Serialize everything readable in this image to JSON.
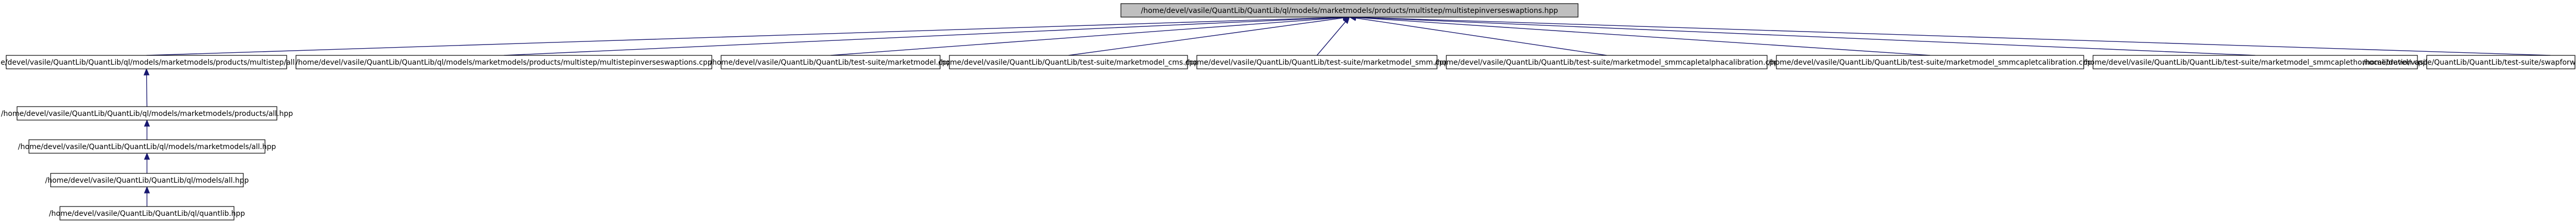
{
  "diagram": {
    "nodes": [
      {
        "id": "root",
        "label": "/home/devel/vasile/QuantLib/QuantLib/ql/models/marketmodels/products/multistep/multistepinverseswaptions.hpp",
        "root": true
      },
      {
        "id": "n_all",
        "label": "/home/devel/vasile/QuantLib/QuantLib/ql/models/marketmodels/products/multistep/all.hpp"
      },
      {
        "id": "n_cpp",
        "label": "/home/devel/vasile/QuantLib/QuantLib/ql/models/marketmodels/products/multistep/multistepinverseswaptions.cpp"
      },
      {
        "id": "n_mm",
        "label": "/home/devel/vasile/QuantLib/QuantLib/test-suite/marketmodel.cpp"
      },
      {
        "id": "n_cms",
        "label": "/home/devel/vasile/QuantLib/QuantLib/test-suite/marketmodel_cms.cpp"
      },
      {
        "id": "n_smm",
        "label": "/home/devel/vasile/QuantLib/QuantLib/test-suite/marketmodel_smm.cpp"
      },
      {
        "id": "n_alpha",
        "label": "/home/devel/vasile/QuantLib/QuantLib/test-suite/marketmodel_smmcapletalphacalibration.cpp"
      },
      {
        "id": "n_caplet",
        "label": "/home/devel/vasile/QuantLib/QuantLib/test-suite/marketmodel_smmcapletcalibration.cpp"
      },
      {
        "id": "n_homo",
        "label": "/home/devel/vasile/QuantLib/QuantLib/test-suite/marketmodel_smmcaplethomocalibration.cpp"
      },
      {
        "id": "n_swap",
        "label": "/home/devel/vasile/QuantLib/QuantLib/test-suite/swapforwardmappings.cpp"
      },
      {
        "id": "n_prod_all",
        "label": "/home/devel/vasile/QuantLib/QuantLib/ql/models/marketmodels/products/all.hpp"
      },
      {
        "id": "n_mm_all",
        "label": "/home/devel/vasile/QuantLib/QuantLib/ql/models/marketmodels/all.hpp"
      },
      {
        "id": "n_models_all",
        "label": "/home/devel/vasile/QuantLib/QuantLib/ql/models/all.hpp"
      },
      {
        "id": "n_quantlib",
        "label": "/home/devel/vasile/QuantLib/QuantLib/ql/quantlib.hpp"
      }
    ],
    "edges": [
      {
        "from": "n_all",
        "to": "root"
      },
      {
        "from": "n_cpp",
        "to": "root"
      },
      {
        "from": "n_mm",
        "to": "root"
      },
      {
        "from": "n_cms",
        "to": "root"
      },
      {
        "from": "n_smm",
        "to": "root"
      },
      {
        "from": "n_alpha",
        "to": "root"
      },
      {
        "from": "n_caplet",
        "to": "root"
      },
      {
        "from": "n_homo",
        "to": "root"
      },
      {
        "from": "n_swap",
        "to": "root"
      },
      {
        "from": "n_prod_all",
        "to": "n_all"
      },
      {
        "from": "n_mm_all",
        "to": "n_prod_all"
      },
      {
        "from": "n_models_all",
        "to": "n_mm_all"
      },
      {
        "from": "n_quantlib",
        "to": "n_models_all"
      }
    ],
    "colors": {
      "root_fill": "#bfbfbf",
      "node_fill": "#ffffff",
      "border": "#000000",
      "edge": "#191970"
    }
  }
}
